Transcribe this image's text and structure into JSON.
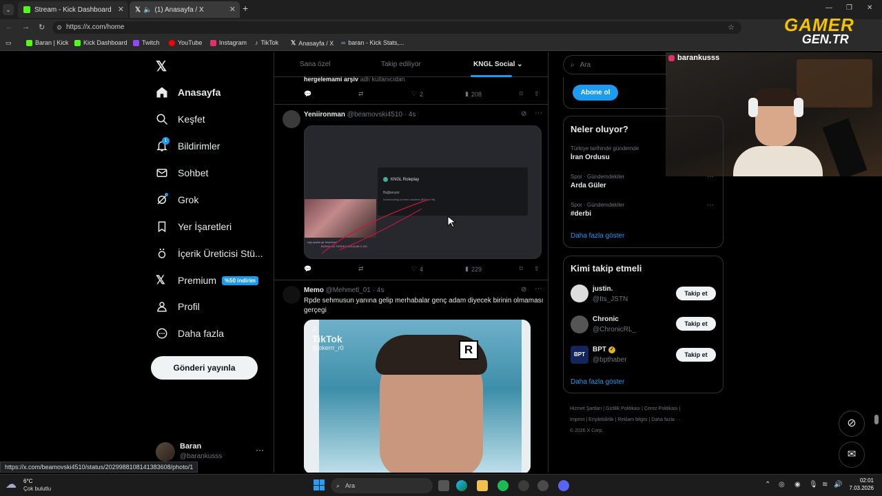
{
  "browser": {
    "tabs": [
      {
        "title": "Stream - Kick Dashboard"
      },
      {
        "title": "(1) Anasayfa / X"
      }
    ],
    "url": "https://x.com/home",
    "bookmarks": [
      "Baran | Kick",
      "Kick Dashboard",
      "Twitch",
      "YouTube",
      "Instagram",
      "TikTok",
      "Anasayfa / X",
      "baran - Kick Stats,..."
    ],
    "status_url": "https://x.com/beamovski4510/status/2029988108141383608/photo/1"
  },
  "overlay": {
    "logo_top": "GAMER",
    "logo_bottom": "GEN.TR",
    "webcam_name": "barankusss"
  },
  "nav": {
    "items": [
      {
        "label": "Anasayfa",
        "icon": "home-icon"
      },
      {
        "label": "Keşfet",
        "icon": "search-icon"
      },
      {
        "label": "Bildirimler",
        "icon": "bell-icon",
        "badge": "1"
      },
      {
        "label": "Sohbet",
        "icon": "mail-icon"
      },
      {
        "label": "Grok",
        "icon": "grok-icon"
      },
      {
        "label": "Yer İşaretleri",
        "icon": "bookmark-icon"
      },
      {
        "label": "İçerik Üreticisi Stü...",
        "icon": "creator-icon"
      },
      {
        "label": "Premium",
        "icon": "x-logo-icon",
        "badge": "%50 indirim"
      },
      {
        "label": "Profil",
        "icon": "person-icon"
      },
      {
        "label": "Daha fazla",
        "icon": "more-circle-icon"
      }
    ],
    "post_button": "Gönderi yayınla",
    "account": {
      "name": "Baran",
      "handle": "@barankusss"
    }
  },
  "feed": {
    "tabs": [
      "Sana özel",
      "Takip ediliyor",
      "KNGL Social"
    ],
    "prev_tweet": {
      "text_bold": "hergelemami arşiv",
      "text_rest": "adlı kullanıcıdan",
      "likes": "2",
      "views": "208"
    },
    "tweets": [
      {
        "name": "Yeniironman",
        "handle": "@beamovski4510",
        "time": "4s",
        "media": {
          "dialog_title": "KNGL Roleplay",
          "dialog_status": "Bağlanıyor",
          "dialog_detail": "Downloading content manifest (85% of 98)",
          "chat_line": "sağ ayakla gir beyefendi",
          "chat_line2": "BURAY DA TÜRKEY BULALIM O ZA!"
        },
        "likes": "4",
        "views": "229"
      },
      {
        "name": "Memo",
        "handle": "@Mehmetl_01",
        "time": "4s",
        "text": "Rpde sehmusun yanına gelip merhabalar genç adam diyecek birinin olmaması gerçegi",
        "media": {
          "watermark": "TikTok",
          "watermark_user": "@okerrr_r0",
          "badge": "R"
        }
      }
    ]
  },
  "right": {
    "search_placeholder": "Ara",
    "subscribe_button": "Abone ol",
    "trends": {
      "title": "Neler oluyor?",
      "items": [
        {
          "context": "Türkiye tarihinde gündemde",
          "name": "İran Ordusu"
        },
        {
          "context": "Spor · Gündemdekiler",
          "name": "Arda Güler"
        },
        {
          "context": "Spor · Gündemdekiler",
          "name": "#derbi"
        }
      ],
      "show_more": "Daha fazla göster"
    },
    "who_to_follow": {
      "title": "Kimi takip etmeli",
      "users": [
        {
          "name": "justin.",
          "handle": "@Its_JSTN",
          "button": "Takip et"
        },
        {
          "name": "Chronic",
          "handle": "@ChronicRL_",
          "button": "Takip et"
        },
        {
          "name": "BPT",
          "handle": "@bpthaber",
          "button": "Takip et",
          "verified": true
        }
      ],
      "show_more": "Daha fazla göster"
    },
    "footer": [
      "Hizmet Şartları",
      "Gizlilik Politikası",
      "Çerez Politikası",
      "Imprint",
      "Erişilebilirlik",
      "Reklam bilgisi",
      "Daha fazla ···",
      "© 2026 X Corp."
    ]
  },
  "taskbar": {
    "weather_temp": "6°C",
    "weather_desc": "Çok bulutlu",
    "search": "Ara",
    "time": "02:01",
    "date": "7.03.2026"
  },
  "colors": {
    "accent": "#1d9bf0",
    "kick": "#53fc18",
    "background": "#000000",
    "border": "#2f3336",
    "muted": "#71767b"
  }
}
